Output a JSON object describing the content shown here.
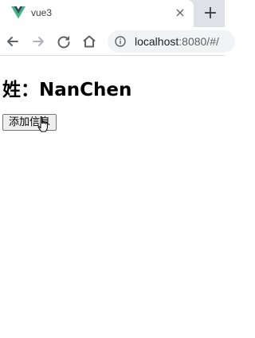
{
  "browser": {
    "tab_title": "vue3",
    "tab_close_glyph": "×",
    "new_tab_glyph": "+",
    "url_host": "localhost",
    "url_rest": ":8080/#/",
    "icons": [
      "vue-logo-icon",
      "close-icon",
      "plus-icon",
      "back-arrow-icon",
      "forward-arrow-icon",
      "reload-icon",
      "home-icon",
      "info-icon"
    ]
  },
  "page": {
    "heading": "姓：NanChen",
    "add_button_label": "添加信息"
  },
  "colors": {
    "tabstrip": "#dee1e6",
    "omnibox": "#f1f3f4",
    "vue_green": "#41b883",
    "vue_dark": "#35495e"
  }
}
